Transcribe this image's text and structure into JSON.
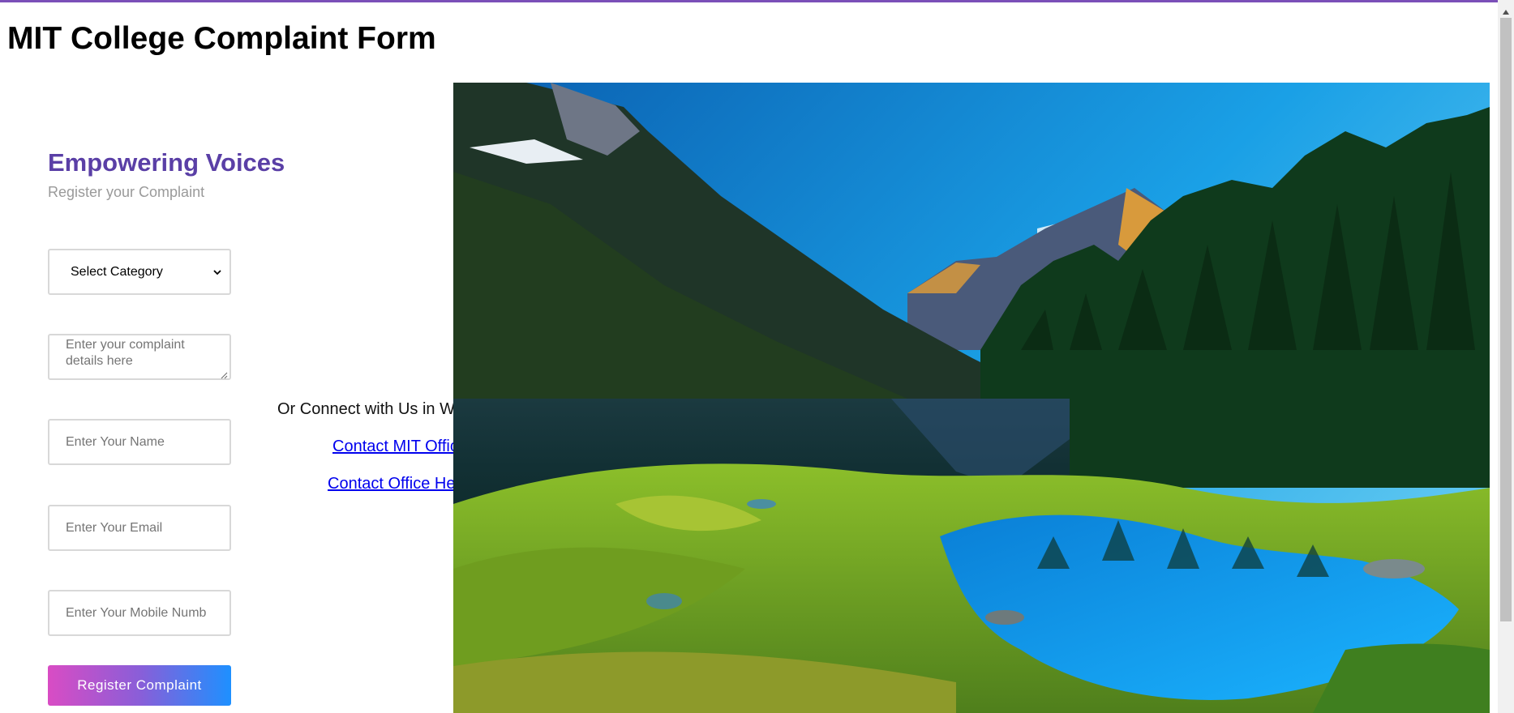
{
  "page": {
    "title": "MIT College Complaint Form"
  },
  "form": {
    "heading": "Empowering Voices",
    "subheading": "Register your Complaint",
    "category_select": {
      "selected_label": "Select Category"
    },
    "complaint_textarea": {
      "placeholder": "Enter your complaint details here"
    },
    "name_input": {
      "placeholder": "Enter Your Name"
    },
    "email_input": {
      "placeholder": "Enter Your Email"
    },
    "mobile_input": {
      "placeholder": "Enter Your Mobile Numb"
    },
    "submit_label": "Register Complaint"
  },
  "connect": {
    "text": "Or Connect with Us in W",
    "links": [
      {
        "label": "Contact MIT Offic"
      },
      {
        "label": "Contact Office He"
      }
    ]
  },
  "image": {
    "subject": "mountain lake landscape"
  },
  "colors": {
    "heading_accent": "#5a3fa6",
    "button_gradient_start": "#d94cc4",
    "button_gradient_end": "#1e90ff",
    "link": "#0000ee"
  }
}
